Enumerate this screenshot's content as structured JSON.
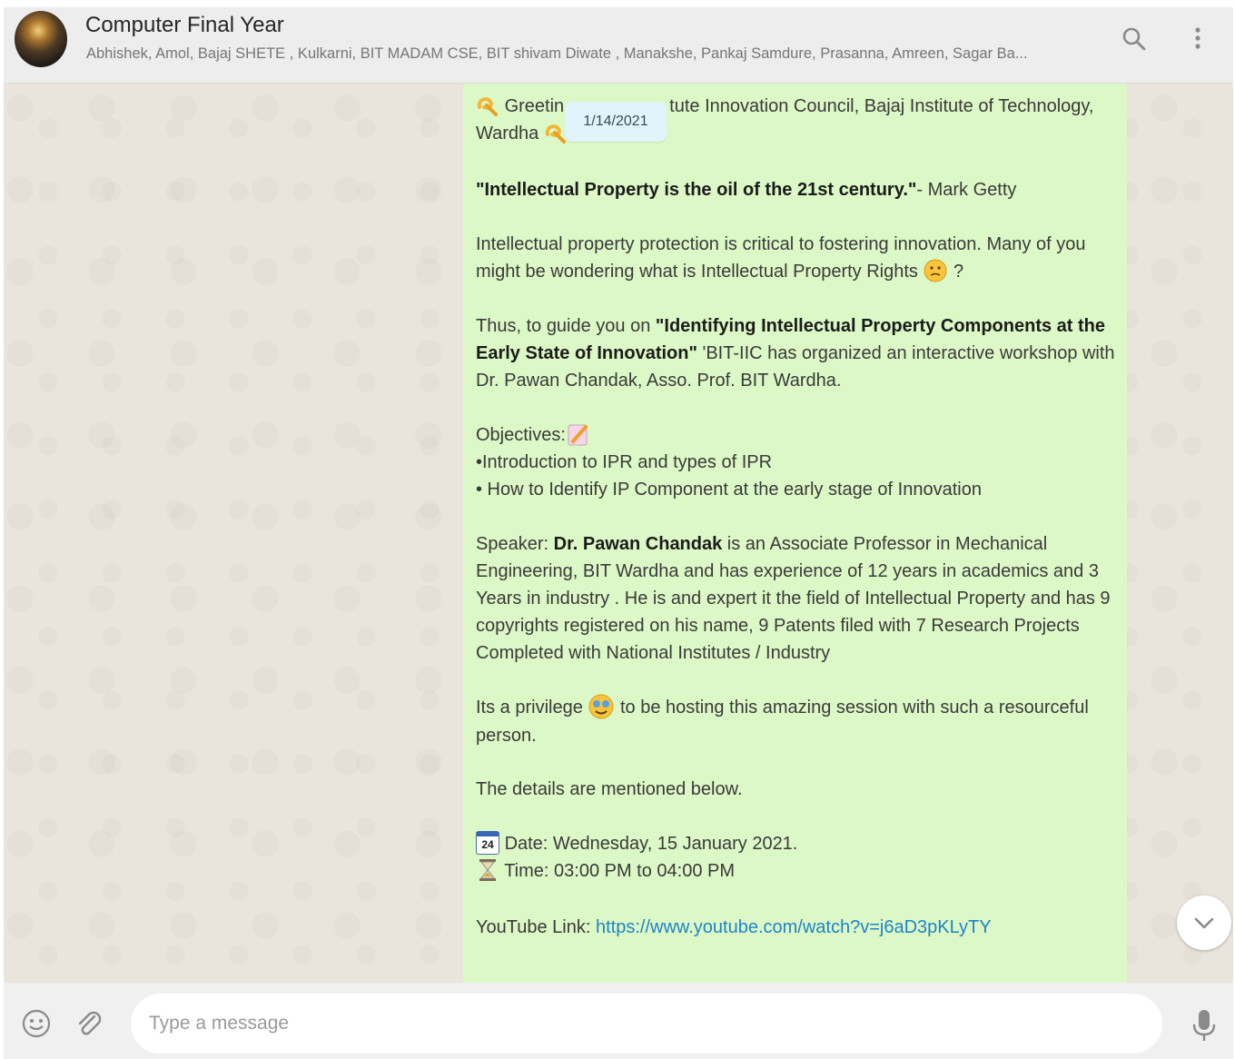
{
  "header": {
    "title": "Computer Final Year",
    "members": "Abhishek, Amol, Bajaj SHETE , Kulkarni, BIT MADAM CSE, BIT shivam Diwate , Manakshe, Pankaj Samdure, Prasanna, Amreen, Sagar Ba...",
    "icons": [
      "search-icon",
      "menu-icon"
    ]
  },
  "date_chip": "1/14/2021",
  "message": {
    "greet_a": "Greetin",
    "greet_b": "tute Innovation Council, Bajaj Institute of Technology,",
    "greet_c": "Wardha",
    "quote_bold": "\"Intellectual Property is the oil of the 21st century.\"",
    "quote_author": "- Mark Getty",
    "intro_1": "Intellectual property protection is critical to fostering innovation.  Many of you",
    "intro_2": "might be wondering what is Intellectual Property Rights",
    "intro_2_end": "?",
    "guide_start": "Thus, to guide you on",
    "guide_bold_1": "\"Identifying Intellectual Property Components at the",
    "guide_bold_2": "Early State of Innovation\"",
    "guide_rest": " 'BIT-IIC has organized an interactive workshop with",
    "guide_line3": "Dr. Pawan Chandak, Asso. Prof. BIT Wardha.",
    "objectives_title": "Objectives:",
    "objective_1": "•Introduction to IPR and types of IPR",
    "objective_2": "• How to Identify IP Component at the early stage of Innovation",
    "speaker_label": "Speaker:",
    "speaker_name": "Dr. Pawan Chandak",
    "speaker_rest_1": " is an Associate Professor in Mechanical",
    "speaker_2": "Engineering, BIT Wardha and has experience of 12 years in academics and 3",
    "speaker_3": "Years in industry . He is and expert it the field of Intellectual Property and has 9",
    "speaker_4": "copyrights registered on his name, 9 Patents filed with 7 Research Projects",
    "speaker_5": "Completed with National Institutes / Industry",
    "privilege_1": "Its a privilege",
    "privilege_1b": " to be hosting this amazing session with such a resourceful",
    "privilege_2": "person.",
    "details": "The details are mentioned below.",
    "date_line": "Date: Wednesday, 15 January 2021.",
    "calendar_day": "24",
    "time_line": "Time: 03:00 PM to 04:00 PM",
    "youtube_label": "YouTube Link:",
    "youtube_url": "https://www.youtube.com/watch?v=j6aD3pKLyTY"
  },
  "footer": {
    "placeholder": "Type a message",
    "icons": [
      "emoji-icon",
      "attach-icon",
      "mic-icon"
    ]
  },
  "colors": {
    "bubble": "#dcf8c6",
    "chat_bg": "#e9e4dc",
    "link": "#1f84c7",
    "header_bg": "#ededed"
  }
}
